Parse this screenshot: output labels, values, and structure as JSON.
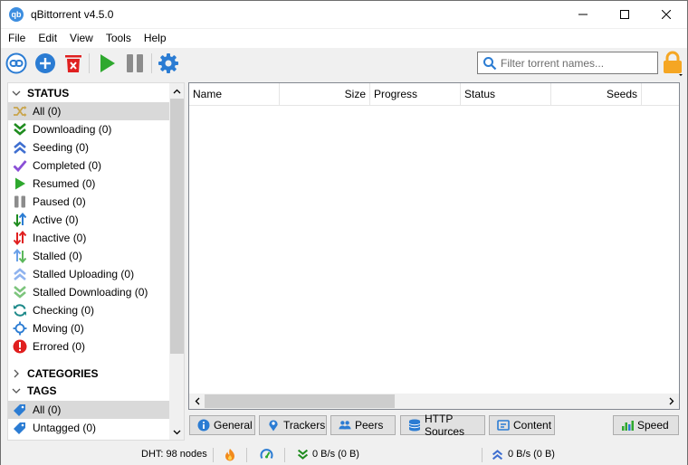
{
  "window": {
    "title": "qBittorrent v4.5.0"
  },
  "menu": [
    "File",
    "Edit",
    "View",
    "Tools",
    "Help"
  ],
  "search": {
    "placeholder": "Filter torrent names..."
  },
  "sidebar": {
    "status_header": "STATUS",
    "status_items": [
      {
        "label": "All (0)",
        "icon": "all-shuffle-icon"
      },
      {
        "label": "Downloading (0)",
        "icon": "downloading-icon"
      },
      {
        "label": "Seeding (0)",
        "icon": "seeding-icon"
      },
      {
        "label": "Completed (0)",
        "icon": "checkmark-icon"
      },
      {
        "label": "Resumed (0)",
        "icon": "play-icon"
      },
      {
        "label": "Paused (0)",
        "icon": "pause-icon"
      },
      {
        "label": "Active (0)",
        "icon": "active-arrows-icon"
      },
      {
        "label": "Inactive (0)",
        "icon": "inactive-arrows-icon"
      },
      {
        "label": "Stalled (0)",
        "icon": "stalled-arrows-icon"
      },
      {
        "label": "Stalled Uploading (0)",
        "icon": "stalled-uploading-icon"
      },
      {
        "label": "Stalled Downloading (0)",
        "icon": "stalled-downloading-icon"
      },
      {
        "label": "Checking (0)",
        "icon": "checking-icon"
      },
      {
        "label": "Moving (0)",
        "icon": "moving-icon"
      },
      {
        "label": "Errored (0)",
        "icon": "error-icon"
      }
    ],
    "categories_header": "CATEGORIES",
    "tags_header": "TAGS",
    "tag_items": [
      {
        "label": "All (0)",
        "icon": "tag-icon"
      },
      {
        "label": "Untagged (0)",
        "icon": "tag-icon"
      }
    ]
  },
  "columns": [
    "Name",
    "Size",
    "Progress",
    "Status",
    "Seeds"
  ],
  "tabs": [
    {
      "label": "General",
      "icon": "info-icon"
    },
    {
      "label": "Trackers",
      "icon": "tracker-pin-icon"
    },
    {
      "label": "Peers",
      "icon": "peers-icon"
    },
    {
      "label": "HTTP Sources",
      "icon": "database-icon"
    },
    {
      "label": "Content",
      "icon": "content-icon"
    },
    {
      "label": "Speed",
      "icon": "speed-chart-icon"
    }
  ],
  "statusbar": {
    "dht": "DHT: 98 nodes",
    "download": "0 B/s (0 B)",
    "upload": "0 B/s (0 B)"
  },
  "colors": {
    "accent": "#2b7cd3",
    "green": "#2ea82e",
    "red": "#e02020",
    "orange": "#f5a623"
  }
}
